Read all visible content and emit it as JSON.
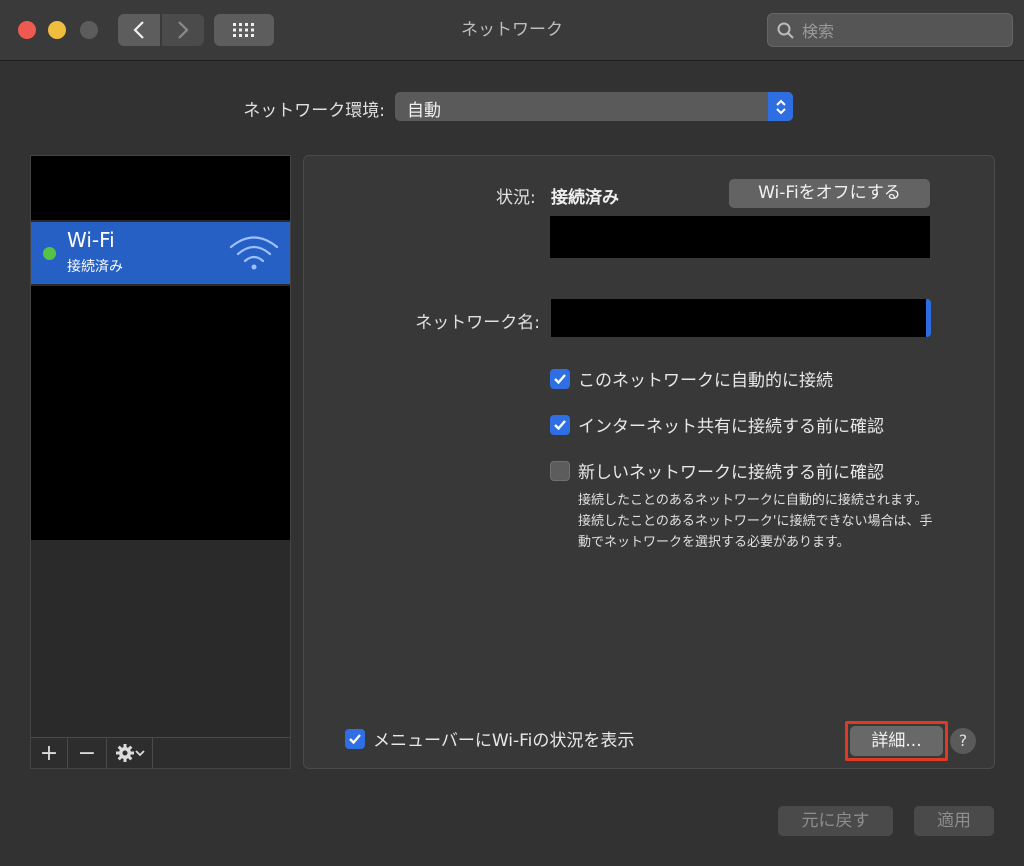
{
  "window": {
    "title": "ネットワーク",
    "search_placeholder": "検索"
  },
  "location": {
    "label": "ネットワーク環境:",
    "value": "自動"
  },
  "sidebar": {
    "services": [
      {
        "name": "Wi-Fi",
        "status": "接続済み",
        "status_color": "#56c24a",
        "selected": true
      }
    ],
    "toolbar": {
      "add": "+",
      "remove": "−"
    }
  },
  "detail": {
    "status_label": "状況:",
    "status_value": "接続済み",
    "wifi_toggle_button": "Wi-Fiをオフにする",
    "network_name_label": "ネットワーク名:",
    "options": [
      {
        "label": "このネットワークに自動的に接続",
        "checked": true
      },
      {
        "label": "インターネット共有に接続する前に確認",
        "checked": true
      },
      {
        "label": "新しいネットワークに接続する前に確認",
        "checked": false
      }
    ],
    "note": "接続したことのあるネットワークに自動的に接続されます。接続したことのあるネットワーク'に接続できない場合は、手動でネットワークを選択する必要があります。",
    "menubar_option": {
      "label": "メニューバーにWi-Fiの状況を表示",
      "checked": true
    },
    "advanced_button": "詳細...",
    "help_button": "?"
  },
  "footer": {
    "revert_button": "元に戻す",
    "apply_button": "適用"
  },
  "colors": {
    "accent": "#2f6fe3",
    "selection": "#2760c5",
    "highlight_border": "#e03a25"
  }
}
